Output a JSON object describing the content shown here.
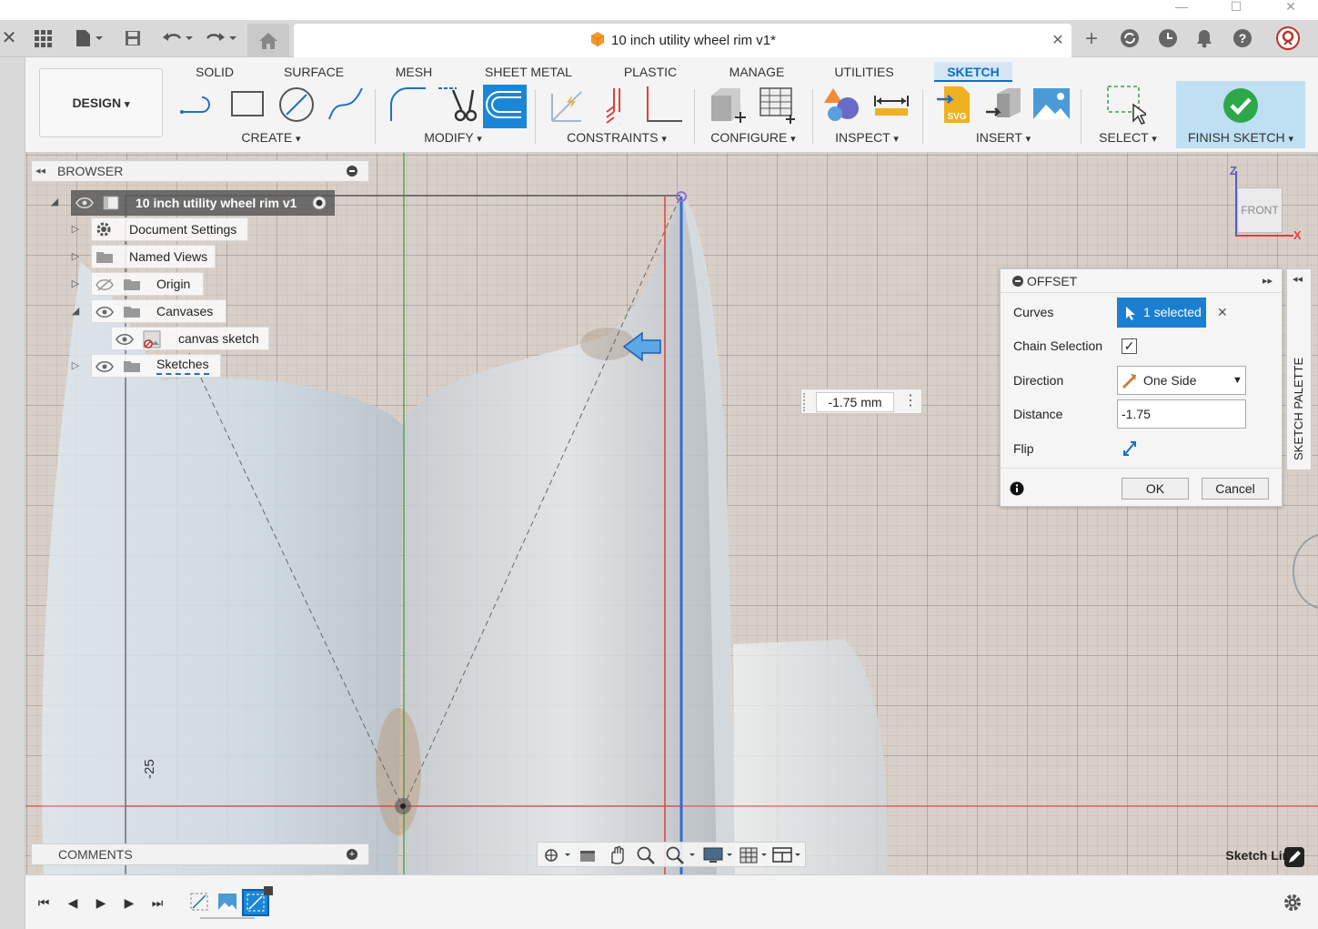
{
  "window": {
    "minimize": "—",
    "maximize": "☐",
    "close": "✕"
  },
  "document": {
    "title": "10 inch utility wheel rim v1*"
  },
  "ribbon": {
    "design_label": "DESIGN",
    "tabs": [
      "SOLID",
      "SURFACE",
      "MESH",
      "SHEET METAL",
      "PLASTIC",
      "MANAGE",
      "UTILITIES",
      "SKETCH"
    ],
    "active_tab": "SKETCH",
    "groups": {
      "create": "CREATE",
      "modify": "MODIFY",
      "constraints": "CONSTRAINTS",
      "configure": "CONFIGURE",
      "inspect": "INSPECT",
      "insert": "INSERT",
      "select": "SELECT",
      "finish": "FINISH SKETCH"
    },
    "dropdown_caret": "▾"
  },
  "browser": {
    "title": "BROWSER",
    "root": "10 inch utility wheel rim v1",
    "items": [
      "Document Settings",
      "Named Views",
      "Origin",
      "Canvases",
      "canvas sketch",
      "Sketches"
    ]
  },
  "viewcube": {
    "face": "FRONT",
    "z": "Z",
    "x": "X"
  },
  "viewport": {
    "dimension_input": "-1.75 mm",
    "axis_label": "-25",
    "status_text": "Sketch Line"
  },
  "offset_dialog": {
    "title": "OFFSET",
    "curves_label": "Curves",
    "curves_value": "1 selected",
    "chain_label": "Chain Selection",
    "chain_checked": true,
    "direction_label": "Direction",
    "direction_value": "One Side",
    "distance_label": "Distance",
    "distance_value": "-1.75",
    "flip_label": "Flip",
    "ok": "OK",
    "cancel": "Cancel"
  },
  "sketch_palette": {
    "label": "SKETCH PALETTE"
  },
  "comments": {
    "title": "COMMENTS"
  },
  "colors": {
    "accent": "#0b6fc6",
    "selected_chip": "#1a7fd0",
    "finish_bg": "#bfe0f3",
    "finish_check": "#2ca84a",
    "sketch_line_blue": "#2b6fd6",
    "axis_red": "#e0403a",
    "axis_green": "#3a9a3a"
  }
}
